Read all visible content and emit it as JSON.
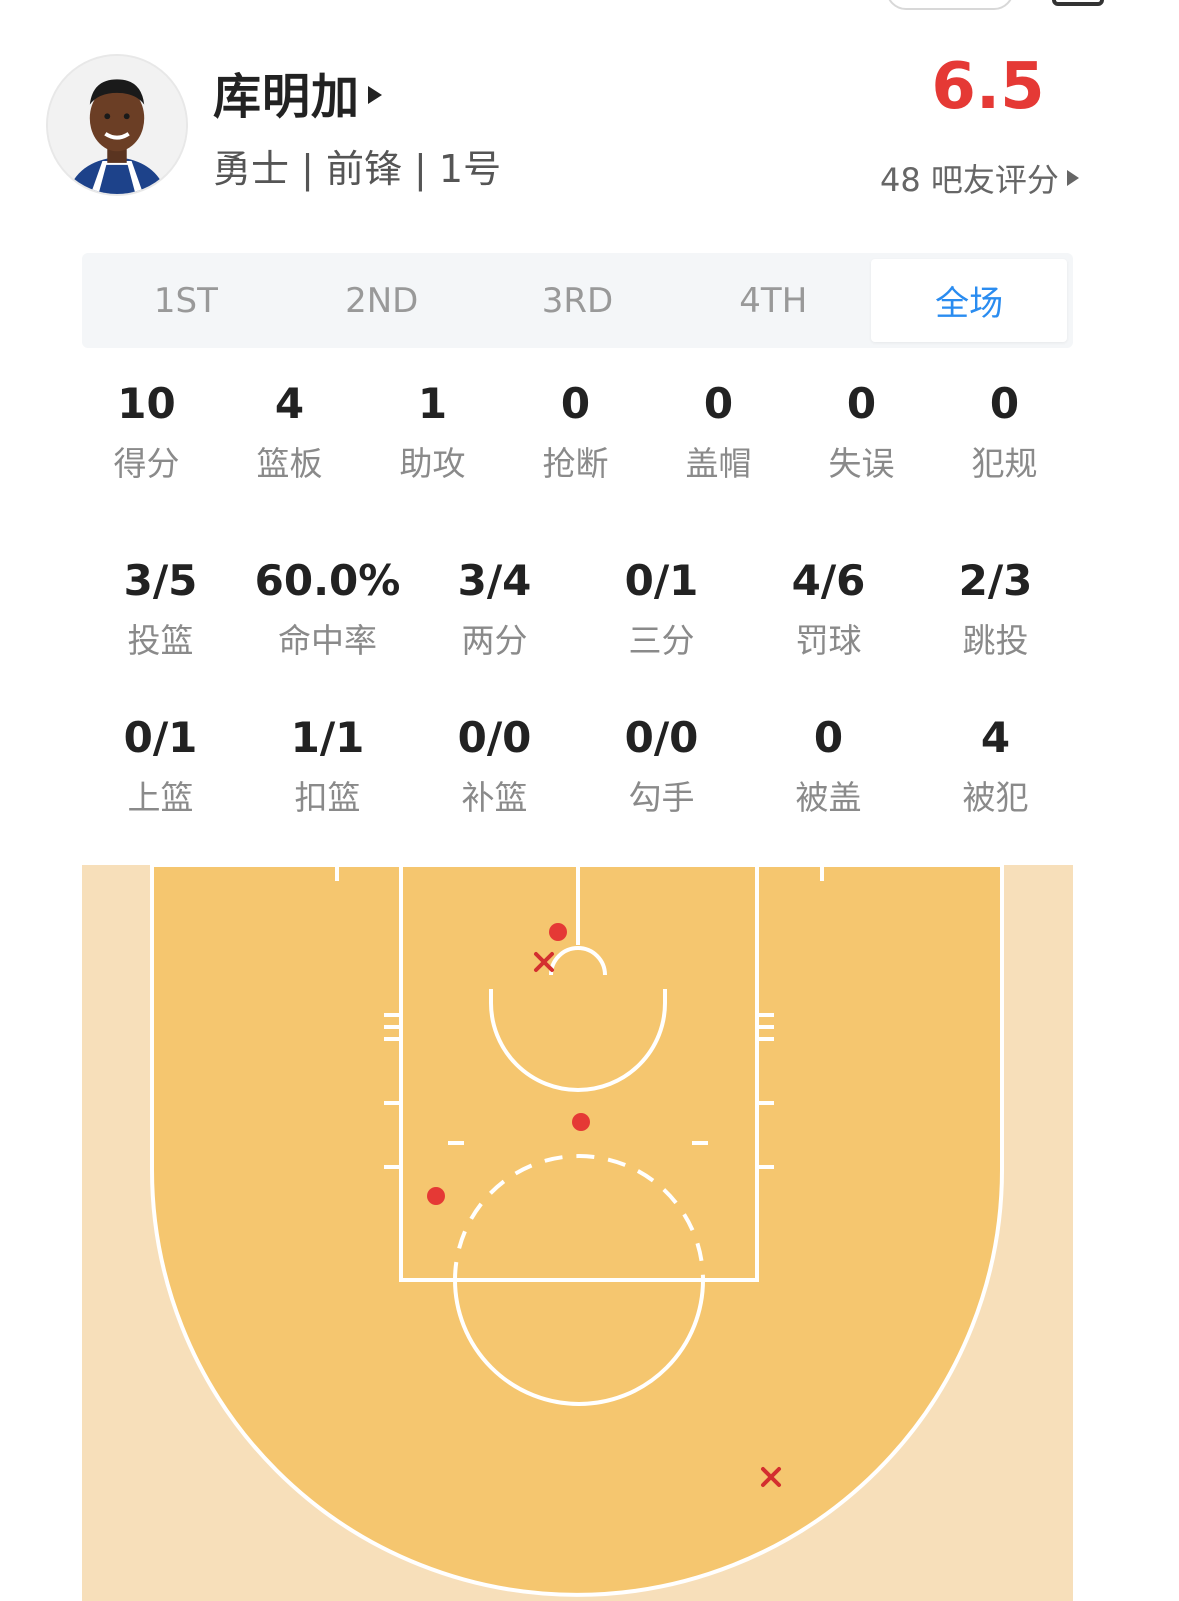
{
  "player": {
    "name": "库明加",
    "meta": "勇士 | 前锋 | 1号",
    "avatar_icon": "player-avatar"
  },
  "rating": {
    "score": "6.5",
    "subtitle": "48 吧友评分",
    "color": "#e53935"
  },
  "tabs": [
    {
      "label": "1ST",
      "active": false
    },
    {
      "label": "2ND",
      "active": false
    },
    {
      "label": "3RD",
      "active": false
    },
    {
      "label": "4TH",
      "active": false
    },
    {
      "label": "全场",
      "active": true
    }
  ],
  "stats_primary": [
    {
      "value": "10",
      "label": "得分"
    },
    {
      "value": "4",
      "label": "篮板"
    },
    {
      "value": "1",
      "label": "助攻"
    },
    {
      "value": "0",
      "label": "抢断"
    },
    {
      "value": "0",
      "label": "盖帽"
    },
    {
      "value": "0",
      "label": "失误"
    },
    {
      "value": "0",
      "label": "犯规"
    }
  ],
  "stats_shooting": [
    {
      "value": "3/5",
      "label": "投篮"
    },
    {
      "value": "60.0%",
      "label": "命中率"
    },
    {
      "value": "3/4",
      "label": "两分"
    },
    {
      "value": "0/1",
      "label": "三分"
    },
    {
      "value": "4/6",
      "label": "罚球"
    },
    {
      "value": "2/3",
      "label": "跳投"
    }
  ],
  "stats_other": [
    {
      "value": "0/1",
      "label": "上篮"
    },
    {
      "value": "1/1",
      "label": "扣篮"
    },
    {
      "value": "0/0",
      "label": "补篮"
    },
    {
      "value": "0/0",
      "label": "勾手"
    },
    {
      "value": "0",
      "label": "被盖"
    },
    {
      "value": "4",
      "label": "被犯"
    }
  ],
  "colors": {
    "accent": "#2a8cf0",
    "made_shot": "#e53935",
    "missed_shot": "#d32f2f",
    "court_inside": "#f5c66f",
    "court_outside": "#f7dfba"
  }
}
